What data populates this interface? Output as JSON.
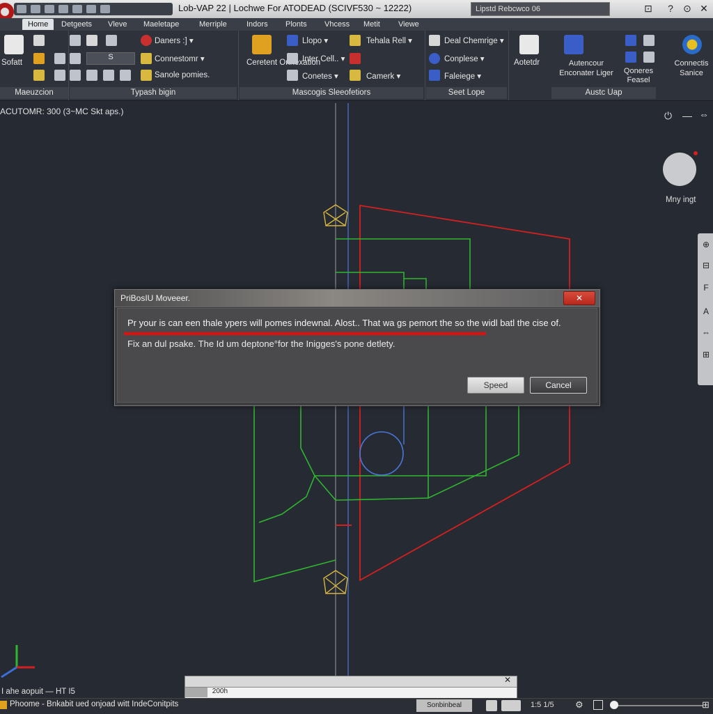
{
  "title_bar": {
    "title": "Lob-VAP 22 | Lochwe For ATODEAD (SCIVF530 ~ 12222)",
    "search_placeholder": "Lipstd Rebcwco 06",
    "window_buttons": [
      "⊡",
      "?",
      "⊙",
      "✕"
    ]
  },
  "menu_tabs": [
    "Home",
    "Detgeets",
    "Vleve",
    "Maeletape",
    "Merriple",
    "Indors",
    "Plonts",
    "Vhcess",
    "Metit",
    "Viewe"
  ],
  "ribbon": {
    "panels": [
      {
        "label": "Maeuzcion",
        "items": [
          "Sofatt"
        ]
      },
      {
        "label": "Typash bigin",
        "items": [
          "Daners :] ▾",
          "Connestomr ▾",
          "Sanole pomies.",
          "S"
        ]
      },
      {
        "label": "Mascogis Sleeofetiors",
        "items": [
          "Ceretent Onnexation",
          "Llopo ▾",
          "Inter Cell.. ▾",
          "Conetes ▾",
          "Tehala Rell ▾",
          "Camerk ▾"
        ]
      },
      {
        "label": "Seet Lope",
        "items": [
          "Deal Chemrige ▾",
          "Conplese ▾",
          "Faleiege ▾"
        ]
      },
      {
        "label": "Austc Uap",
        "items": [
          "Aotetdr",
          "Autencour Enconater Liger",
          "Qoneres Feasel",
          "Connectis Sanice"
        ]
      }
    ]
  },
  "viewport": {
    "label": "ACUTOMR: 300 (3~MC Skt aps.)",
    "nav_label": "Mny ingt",
    "navbar_items": [
      "⊕",
      "⊟",
      "F",
      "A",
      "⇔",
      "⊞"
    ]
  },
  "dialog": {
    "title": "PriBosIU Moveeer.",
    "line1": "Pr your is can een thale ypers will pomes indewnal. Alost.. That wa gs pemort the so the widl batl the cise of.",
    "line2": "Fix an dul psake. The Id um deptone°for the Inigges's pone detlety.",
    "ok_label": "Speed",
    "cancel_label": "Cancel",
    "close_label": "✕"
  },
  "command_line": {
    "close": "✕",
    "input_value": "200h"
  },
  "status": {
    "coords": "I ahe aopuit — HT I5",
    "text": "Phoome - Bnkabit ued onjoad witt IndeConitpits",
    "right_badge": "Sonbinbeal",
    "scale": "1:5 1/5"
  },
  "colors": {
    "background": "#262a32",
    "red_geometry": "#d42020",
    "green_geometry": "#31b531",
    "blue_geometry": "#3c6ed6",
    "yellow_markers": "#d6b640"
  }
}
